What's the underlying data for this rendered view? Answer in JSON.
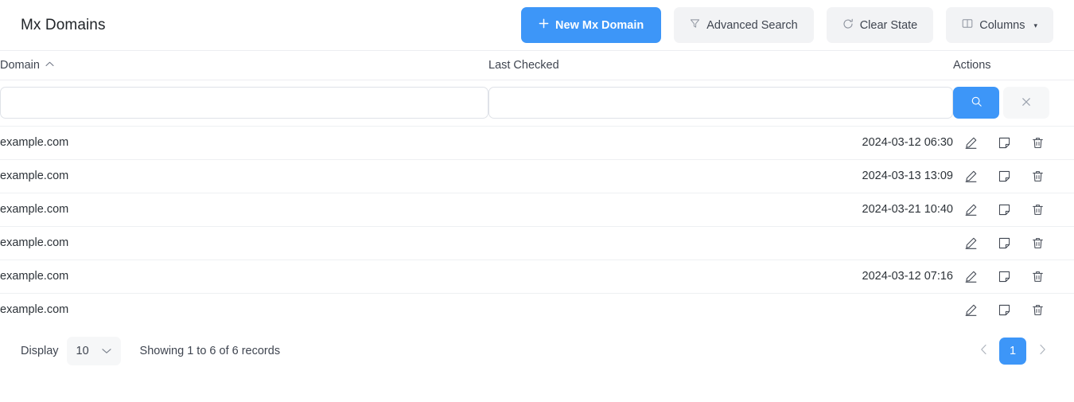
{
  "header": {
    "title": "Mx Domains",
    "buttons": [
      {
        "id": "new",
        "label": "New Mx Domain",
        "icon": "plus-icon",
        "style": "primary"
      },
      {
        "id": "advanced_search",
        "label": "Advanced Search",
        "icon": "filter-icon",
        "style": "light"
      },
      {
        "id": "clear_state",
        "label": "Clear State",
        "icon": "refresh-icon",
        "style": "light"
      },
      {
        "id": "columns",
        "label": "Columns",
        "icon": "columns-icon",
        "style": "light",
        "caret": "▾"
      }
    ]
  },
  "table": {
    "columns": [
      {
        "key": "domain",
        "label": "Domain",
        "sort": "asc",
        "sort_icon": "caret-up-icon"
      },
      {
        "key": "last_checked",
        "label": "Last Checked"
      },
      {
        "key": "actions",
        "label": "Actions"
      }
    ],
    "filters": {
      "domain_value": "",
      "domain_placeholder": "",
      "last_checked_value": "",
      "last_checked_placeholder": "",
      "search_icon": "search-icon",
      "clear_icon": "close-icon"
    },
    "row_actions": [
      {
        "name": "edit-icon",
        "title": "Edit"
      },
      {
        "name": "note-icon",
        "title": "Note"
      },
      {
        "name": "delete-icon",
        "title": "Delete"
      }
    ],
    "rows": [
      {
        "domain": "example.com",
        "last_checked": "2024-03-12 06:30"
      },
      {
        "domain": "example.com",
        "last_checked": "2024-03-13 13:09"
      },
      {
        "domain": "example.com",
        "last_checked": "2024-03-21 10:40"
      },
      {
        "domain": "example.com",
        "last_checked": ""
      },
      {
        "domain": "example.com",
        "last_checked": "2024-03-12 07:16"
      },
      {
        "domain": "example.com",
        "last_checked": ""
      }
    ]
  },
  "footer": {
    "display_label": "Display",
    "display_value": "10",
    "display_chevron": "chevron-down-icon",
    "showing_text": "Showing 1 to 6 of 6 records",
    "pagination": {
      "prev_icon": "chevron-left-icon",
      "next_icon": "chevron-right-icon",
      "current_page": "1"
    }
  },
  "colors": {
    "accent": "#3d96f8",
    "light_button": "#f2f3f5",
    "border": "#eceef1",
    "text": "#2c3238"
  }
}
